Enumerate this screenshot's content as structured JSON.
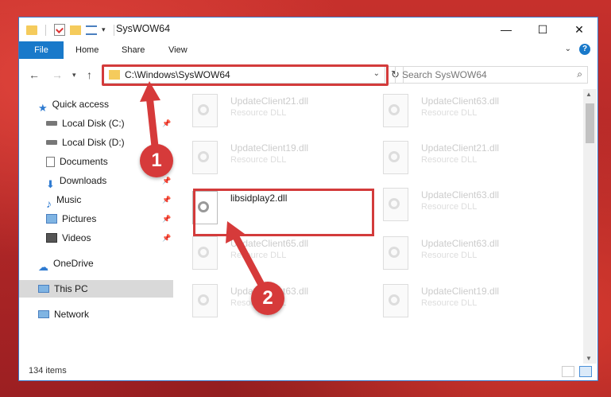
{
  "window": {
    "title": "SysWOW64"
  },
  "controls": {
    "minimize": "—",
    "maximize": "☐",
    "close": "✕"
  },
  "ribbon": {
    "tabs": [
      "File",
      "Home",
      "Share",
      "View"
    ]
  },
  "address": {
    "path": "C:\\Windows\\SysWOW64"
  },
  "search": {
    "placeholder": "Search SysWOW64"
  },
  "nav": {
    "quick_access": "Quick access",
    "items": [
      "Local Disk (C:)",
      "Local Disk (D:)",
      "Documents",
      "Downloads",
      "Music",
      "Pictures",
      "Videos"
    ],
    "onedrive": "OneDrive",
    "thispc": "This PC",
    "network": "Network"
  },
  "files": {
    "type": "Resource DLL",
    "names": [
      "UpdateClient21.dll",
      "UpdateClient63.dll",
      "UpdateClient19.dll",
      "UpdateClient21.dll",
      "UpdateClient63.dll",
      "UpdateClient65.dll",
      "UpdateClient63.dll",
      "UpdateClient63.dll",
      "UpdateClient19.dll"
    ],
    "highlighted": "libsidplay2.dll"
  },
  "status": {
    "count": "134 items"
  },
  "callouts": [
    "1",
    "2"
  ],
  "colors": {
    "accent": "#1979ca",
    "highlight": "#d33b3b",
    "folder": "#f5cb5c"
  }
}
